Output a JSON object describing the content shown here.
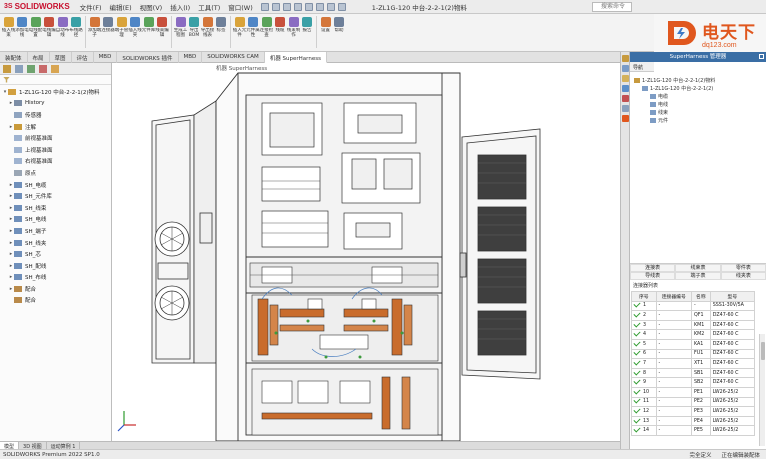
{
  "app": {
    "logo": "SOLIDWORKS",
    "logo_prefix": "3S",
    "doc_title": "1-ZL1G-120 中台-2-2-1(2)物料",
    "window_search": "搜索命令"
  },
  "menu": [
    "文件(F)",
    "编辑(E)",
    "视图(V)",
    "插入(I)",
    "工具(T)",
    "窗口(W)"
  ],
  "ribbon": {
    "groups": [
      [
        "插入线束",
        "添加电线",
        "电线配置",
        "电线编辑",
        "自动布线",
        "布线路径"
      ],
      [
        "添加端子",
        "连接器",
        "端子管理",
        "插入线夹",
        "元件库",
        "线束编辑"
      ],
      [
        "生成工程图",
        "导出BOM",
        "导出接线表",
        "标签"
      ],
      [
        "插入元件",
        "元件属性",
        "连接检查",
        "线缆",
        "线束制作",
        "报告"
      ],
      [
        "设置",
        "帮助"
      ]
    ]
  },
  "brand": {
    "main": "电天下",
    "sub": "dq123.com"
  },
  "doc_tabs": [
    "装配体",
    "布局",
    "草图",
    "评估",
    "MBD",
    "SOLIDWORKS 插件",
    "MBD",
    "SOLIDWORKS CAM",
    "机器 SuperHarness"
  ],
  "viewport": {
    "title": "机器 SuperHarness"
  },
  "feature_tree": [
    {
      "label": "1-ZL1G-120 中台-2-2-1(2)物料",
      "toggle": "▾",
      "color": "#d2a040"
    },
    {
      "label": "History",
      "toggle": "▸",
      "color": "#7d8ea6"
    },
    {
      "label": "传感器",
      "toggle": "",
      "color": "#8fa4c0"
    },
    {
      "label": "注解",
      "toggle": "▸",
      "color": "#c99a3a"
    },
    {
      "label": "前视基准面",
      "toggle": "",
      "color": "#9fb3d0"
    },
    {
      "label": "上视基准面",
      "toggle": "",
      "color": "#9fb3d0"
    },
    {
      "label": "右视基准面",
      "toggle": "",
      "color": "#9fb3d0"
    },
    {
      "label": "原点",
      "toggle": "",
      "color": "#9aa6b4"
    },
    {
      "label": "SH_电缆",
      "toggle": "▸",
      "color": "#6f8fba"
    },
    {
      "label": "SH_元件库",
      "toggle": "▸",
      "color": "#6f8fba"
    },
    {
      "label": "SH_线束",
      "toggle": "▸",
      "color": "#6f8fba"
    },
    {
      "label": "SH_电线",
      "toggle": "▸",
      "color": "#6f8fba"
    },
    {
      "label": "SH_端子",
      "toggle": "▸",
      "color": "#6f8fba"
    },
    {
      "label": "SH_线夹",
      "toggle": "▸",
      "color": "#6f8fba"
    },
    {
      "label": "SH_芯",
      "toggle": "▸",
      "color": "#6f8fba"
    },
    {
      "label": "SH_配线",
      "toggle": "▸",
      "color": "#6f8fba"
    },
    {
      "label": "SH_布线",
      "toggle": "▸",
      "color": "#6f8fba"
    },
    {
      "label": "配合",
      "toggle": "▸",
      "color": "#b98a4a"
    },
    {
      "label": "配合",
      "toggle": "",
      "color": "#b98a4a"
    }
  ],
  "bottom_tabs": [
    "模型",
    "3D 视图",
    "运动算例 1"
  ],
  "status": {
    "left": "SOLIDWORKS Premium 2022 SP1.0",
    "right": [
      "完全定义",
      "正在编辑装配体"
    ]
  },
  "right_panel": {
    "title": "SuperHarness 管理器",
    "tab": "导航",
    "tree": [
      {
        "label": "1-ZL1G-120 中台-2-2-1(2)物料",
        "indent": 0
      },
      {
        "label": "1-ZL1G-120 中台-2-2-1(2)",
        "indent": 1
      },
      {
        "label": "电缆",
        "indent": 2
      },
      {
        "label": "电线",
        "indent": 2
      },
      {
        "label": "线束",
        "indent": 2
      },
      {
        "label": "元件",
        "indent": 2
      }
    ],
    "buttons": [
      "连接表",
      "线束表",
      "零件表",
      "导线表",
      "端子表",
      "线夹表"
    ],
    "table_label": "连接器列表",
    "table_headers": [
      "序号",
      "连接器编号",
      "名称",
      "型号"
    ],
    "rows": [
      {
        "no": "1",
        "name": "-",
        "code": "-",
        "model": "SSS1-30V/5A"
      },
      {
        "no": "2",
        "name": "-",
        "code": "QF1",
        "model": "DZ47-60 C"
      },
      {
        "no": "3",
        "name": "-",
        "code": "KM1",
        "model": "DZ47-60 C"
      },
      {
        "no": "4",
        "name": "-",
        "code": "KM2",
        "model": "DZ47-60 C"
      },
      {
        "no": "5",
        "name": "-",
        "code": "KA1",
        "model": "DZ47-60 C"
      },
      {
        "no": "6",
        "name": "-",
        "code": "FU1",
        "model": "DZ47-60 C"
      },
      {
        "no": "7",
        "name": "-",
        "code": "XT1",
        "model": "DZ47-60 C"
      },
      {
        "no": "8",
        "name": "-",
        "code": "SB1",
        "model": "DZ47-60 C"
      },
      {
        "no": "9",
        "name": "-",
        "code": "SB2",
        "model": "DZ47-60 C"
      },
      {
        "no": "10",
        "name": "-",
        "code": "PE1",
        "model": "LW26-25/2"
      },
      {
        "no": "11",
        "name": "-",
        "code": "PE2",
        "model": "LW26-25/2"
      },
      {
        "no": "12",
        "name": "-",
        "code": "PE3",
        "model": "LW26-25/2"
      },
      {
        "no": "13",
        "name": "-",
        "code": "PE4",
        "model": "LW26-25/2"
      },
      {
        "no": "14",
        "name": "-",
        "code": "PE5",
        "model": "LW26-25/2"
      }
    ]
  }
}
